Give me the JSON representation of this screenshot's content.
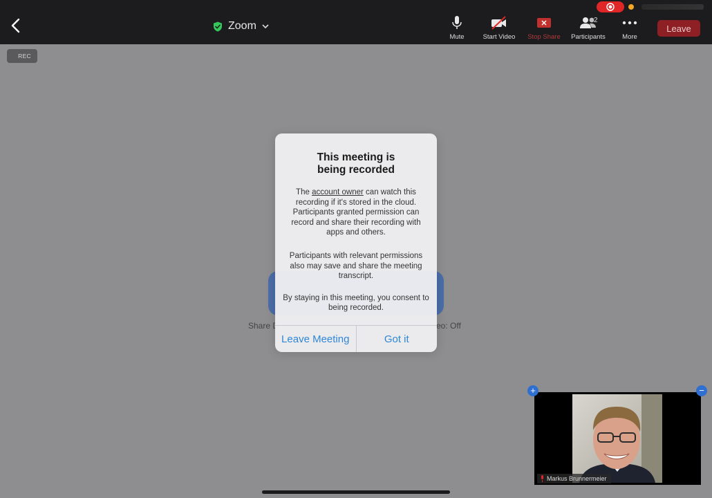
{
  "header": {
    "title": "Zoom",
    "tools": [
      {
        "label": "Mute",
        "icon": "microphone-icon"
      },
      {
        "label": "Start Video",
        "icon": "video-off-icon"
      },
      {
        "label": "Stop Share",
        "icon": "stop-share-icon"
      },
      {
        "label": "Participants",
        "icon": "participants-icon",
        "count": "2"
      },
      {
        "label": "More",
        "icon": "more-icon"
      }
    ],
    "leave_label": "Leave"
  },
  "rec_badge": "REC",
  "background": {
    "left_label": "Share D",
    "right_label": "eo: Off"
  },
  "dialog": {
    "title": "This meeting is being recorded",
    "p1_before": "The ",
    "p1_link": "account owner",
    "p1_after": " can watch this recording if it's stored in the cloud. Participants granted permission can record and share their recording with apps and others.",
    "p2": "Participants with relevant permissions also may save and share the meeting transcript.",
    "p3": "By staying in this meeting, you consent to being recorded.",
    "leave_button": "Leave Meeting",
    "ok_button": "Got it"
  },
  "video": {
    "name": "Markus Brunnermeier"
  },
  "colors": {
    "accent": "#2f86d6",
    "leave": "#8e1f24",
    "recording": "#e02727"
  }
}
